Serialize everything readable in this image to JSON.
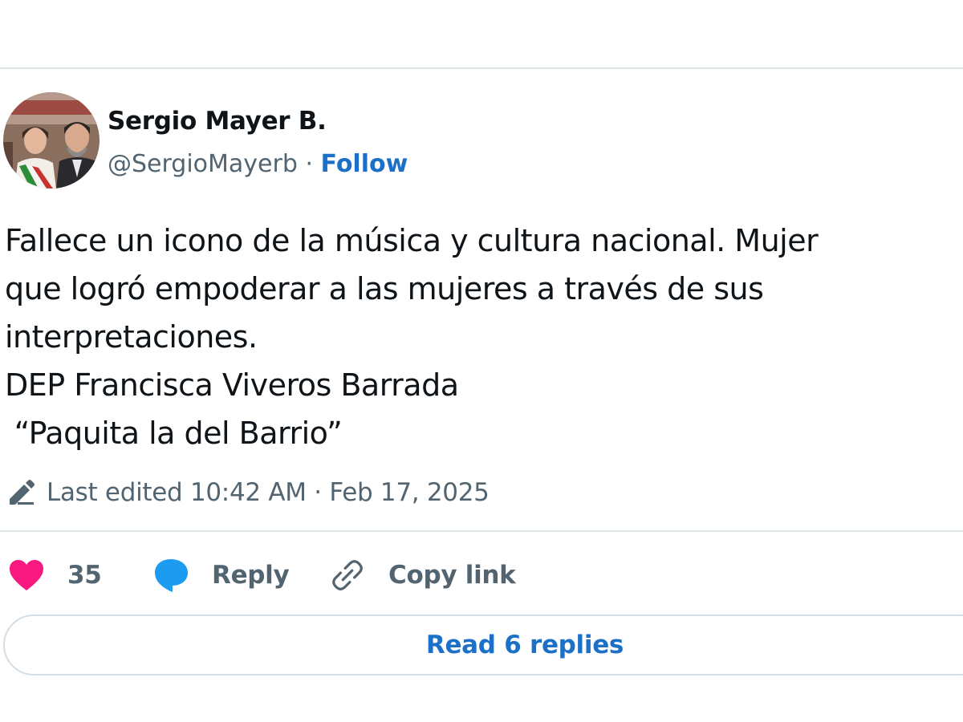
{
  "author": {
    "name": "Sergio Mayer B.",
    "handle": "@SergioMayerb",
    "separator": "·",
    "follow_label": "Follow",
    "avatar_icon": "profile-photo"
  },
  "tweet": {
    "text": "Fallece un icono de la música y cultura nacional. Mujer\nque logró empoderar a las mujeres a través de sus\ninterpretaciones.\nDEP Francisca Viveros Barrada\n “Paquita la del Barrio”",
    "edited_label": "Last edited 10:42 AM · Feb 17, 2025",
    "edited_icon": "pencil-icon"
  },
  "actions": {
    "like_count": "35",
    "like_icon": "heart-icon",
    "like_color": "#f91880",
    "reply_label": "Reply",
    "reply_icon": "speech-bubble-icon",
    "reply_color": "#1d9bf0",
    "copy_label": "Copy link",
    "copy_icon": "link-icon"
  },
  "replies_button": {
    "label": "Read 6 replies"
  },
  "colors": {
    "accent": "#1d70c8",
    "secondary_text": "#536471",
    "divider": "#dfe6ea"
  }
}
